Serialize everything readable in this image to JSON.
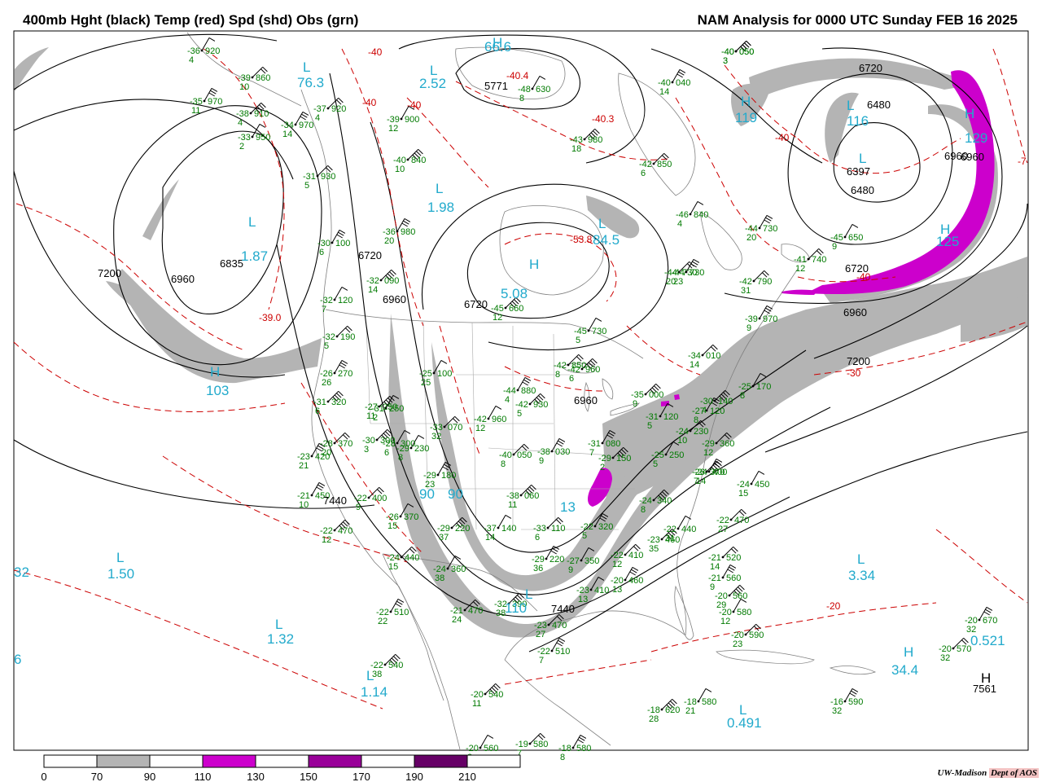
{
  "header": {
    "title_left": "400mb Hght (black) Temp (red) Spd (shd) Obs (grn)",
    "title_right": "NAM Analysis for 0000 UTC Sunday  FEB 16 2025"
  },
  "colors": {
    "height": "#000000",
    "temp": "#cc0000",
    "obs": "#007a00",
    "speed_label": "#22aacc",
    "shade_70": "#b4b4b4",
    "shade_110": "#cc00cc",
    "shade_150": "#990099",
    "shade_190": "#660066"
  },
  "legend": {
    "ticks": [
      "0",
      "70",
      "90",
      "110",
      "130",
      "150",
      "170",
      "190",
      "210"
    ]
  },
  "height_labels": [
    {
      "text": "6720"
    },
    {
      "text": "6480"
    },
    {
      "text": "6397"
    },
    {
      "text": "6480"
    },
    {
      "text": "6720"
    },
    {
      "text": "6960"
    },
    {
      "text": "6960"
    },
    {
      "text": "7200"
    },
    {
      "text": "7200"
    },
    {
      "text": "6960"
    },
    {
      "text": "6835"
    },
    {
      "text": "6960"
    },
    {
      "text": "6720"
    },
    {
      "text": "5771"
    },
    {
      "text": "6960"
    },
    {
      "text": "7440"
    },
    {
      "text": "7440"
    },
    {
      "text": "7561"
    },
    {
      "text": "6720"
    },
    {
      "text": "6960"
    }
  ],
  "temp_labels": [
    {
      "text": "-40"
    },
    {
      "text": "-40"
    },
    {
      "text": "-40"
    },
    {
      "text": "-40.4"
    },
    {
      "text": "-40.3"
    },
    {
      "text": "-53.8"
    },
    {
      "text": "-39.0"
    },
    {
      "text": "-40"
    },
    {
      "text": "-30"
    },
    {
      "text": "-20"
    },
    {
      "text": "-40"
    },
    {
      "text": "-7"
    }
  ],
  "speed_labels": [
    {
      "text": "66.6"
    },
    {
      "text": "76.3"
    },
    {
      "text": "2.52"
    },
    {
      "text": "1.98"
    },
    {
      "text": "1.87"
    },
    {
      "text": "5.08"
    },
    {
      "text": "84.5"
    },
    {
      "text": "103"
    },
    {
      "text": "1.50"
    },
    {
      "text": "1.32"
    },
    {
      "text": "1.14"
    },
    {
      "text": "0.491"
    },
    {
      "text": "3.34"
    },
    {
      "text": "0.521"
    },
    {
      "text": "34.4"
    },
    {
      "text": "129"
    },
    {
      "text": "125"
    },
    {
      "text": "119"
    },
    {
      "text": "116"
    },
    {
      "text": "90"
    },
    {
      "text": "90"
    },
    {
      "text": "110"
    },
    {
      "text": "13"
    },
    {
      "text": "32"
    },
    {
      "text": "6"
    }
  ],
  "pressure_centers": [
    {
      "text": "H"
    },
    {
      "text": "L"
    },
    {
      "text": "L"
    },
    {
      "text": "L"
    },
    {
      "text": "L"
    },
    {
      "text": "H"
    },
    {
      "text": "L"
    },
    {
      "text": "H"
    },
    {
      "text": "L"
    },
    {
      "text": "L"
    },
    {
      "text": "L"
    },
    {
      "text": "L"
    },
    {
      "text": "L"
    },
    {
      "text": "H"
    },
    {
      "text": "H"
    },
    {
      "text": "H"
    },
    {
      "text": "L"
    },
    {
      "text": "H"
    },
    {
      "text": "L"
    },
    {
      "text": "L"
    },
    {
      "text": "H"
    }
  ],
  "observations": [
    {
      "t": "-36",
      "h": "920",
      "d": "4"
    },
    {
      "t": "-39",
      "h": "860",
      "d": "10"
    },
    {
      "t": "-35",
      "h": "970",
      "d": "11"
    },
    {
      "t": "-38",
      "h": "910",
      "d": "4"
    },
    {
      "t": "-33",
      "h": "950",
      "d": "2"
    },
    {
      "t": "-31",
      "h": "930",
      "d": "5"
    },
    {
      "t": "-30",
      "h": "100",
      "d": "6"
    },
    {
      "t": "-32",
      "h": "090",
      "d": "14"
    },
    {
      "t": "-32",
      "h": "120",
      "d": "7"
    },
    {
      "t": "-32",
      "h": "190",
      "d": "5"
    },
    {
      "t": "-26",
      "h": "270",
      "d": "26"
    },
    {
      "t": "-31",
      "h": "320",
      "d": "6"
    },
    {
      "t": "-31",
      "h": "250",
      "d": "2"
    },
    {
      "t": "-28",
      "h": "370",
      "d": "20"
    },
    {
      "t": "-23",
      "h": "420",
      "d": "21"
    },
    {
      "t": "-30",
      "h": "300",
      "d": "3"
    },
    {
      "t": "-29",
      "h": "230",
      "d": "8"
    },
    {
      "t": "-22",
      "h": "400",
      "d": "9"
    },
    {
      "t": "-21",
      "h": "450",
      "d": "10"
    },
    {
      "t": "-22",
      "h": "470",
      "d": "12"
    },
    {
      "t": "-26",
      "h": "370",
      "d": "15"
    },
    {
      "t": "-24",
      "h": "440",
      "d": "15"
    },
    {
      "t": "-22",
      "h": "510",
      "d": "22"
    },
    {
      "t": "-22",
      "h": "540",
      "d": "38"
    },
    {
      "t": "-25",
      "h": "100",
      "d": "25"
    },
    {
      "t": "-33",
      "h": "070",
      "d": "32"
    },
    {
      "t": "-29",
      "h": "180",
      "d": "23"
    },
    {
      "t": "-29",
      "h": "220",
      "d": "37"
    },
    {
      "t": "-24",
      "h": "360",
      "d": "38"
    },
    {
      "t": "-21",
      "h": "470",
      "d": "24"
    },
    {
      "t": "-36",
      "h": "980",
      "d": "20"
    },
    {
      "t": "-40",
      "h": "840",
      "d": "10"
    },
    {
      "t": "-39",
      "h": "900",
      "d": "12"
    },
    {
      "t": "-37",
      "h": "920",
      "d": "4"
    },
    {
      "t": "-34",
      "h": "970",
      "d": "14"
    },
    {
      "t": "-43",
      "h": "980",
      "d": "18"
    },
    {
      "t": "-48",
      "h": "630",
      "d": "8"
    },
    {
      "t": "-42",
      "h": "850",
      "d": "6"
    },
    {
      "t": "-40",
      "h": "040",
      "d": "14"
    },
    {
      "t": "-40",
      "h": "050",
      "d": "3"
    },
    {
      "t": "-46",
      "h": "840",
      "d": "4"
    },
    {
      "t": "-44",
      "h": "730",
      "d": "20"
    },
    {
      "t": "-44",
      "h": "730",
      "d": "23"
    },
    {
      "t": "-45",
      "h": "660",
      "d": "12"
    },
    {
      "t": "-45",
      "h": "730",
      "d": "5"
    },
    {
      "t": "-42",
      "h": "850",
      "d": "8"
    },
    {
      "t": "-44",
      "h": "880",
      "d": "4"
    },
    {
      "t": "-42",
      "h": "930",
      "d": "5"
    },
    {
      "t": "-42",
      "h": "960",
      "d": "12"
    },
    {
      "t": "-40",
      "h": "050",
      "d": "8"
    },
    {
      "t": "-38",
      "h": "030",
      "d": "9"
    },
    {
      "t": "-38",
      "h": "060",
      "d": "11"
    },
    {
      "t": "-37",
      "h": "140",
      "d": "14"
    },
    {
      "t": "-33",
      "h": "110",
      "d": "6"
    },
    {
      "t": "-29",
      "h": "220",
      "d": "36"
    },
    {
      "t": "-32",
      "h": "390",
      "d": "38"
    },
    {
      "t": "-27",
      "h": "350",
      "d": "9"
    },
    {
      "t": "-23",
      "h": "470",
      "d": "27"
    },
    {
      "t": "-22",
      "h": "510",
      "d": "7"
    },
    {
      "t": "-20",
      "h": "540",
      "d": "11"
    },
    {
      "t": "-20",
      "h": "560",
      "d": "8"
    },
    {
      "t": "-19",
      "h": "580",
      "d": "7"
    },
    {
      "t": "-18",
      "h": "580",
      "d": "8"
    },
    {
      "t": "-35",
      "h": "000",
      "d": "9"
    },
    {
      "t": "-31",
      "h": "120",
      "d": "5"
    },
    {
      "t": "-34",
      "h": "010",
      "d": "14"
    },
    {
      "t": "-31",
      "h": "080",
      "d": "7"
    },
    {
      "t": "-29",
      "h": "150",
      "d": "2"
    },
    {
      "t": "-25",
      "h": "250",
      "d": "5"
    },
    {
      "t": "-24",
      "h": "230",
      "d": "10"
    },
    {
      "t": "-24",
      "h": "400",
      "d": "14"
    },
    {
      "t": "-24",
      "h": "340",
      "d": "8"
    },
    {
      "t": "-23",
      "h": "410",
      "d": "13"
    },
    {
      "t": "-22",
      "h": "410",
      "d": "12"
    },
    {
      "t": "-22",
      "h": "320",
      "d": "5"
    },
    {
      "t": "-26",
      "h": "370",
      "d": "7"
    },
    {
      "t": "-24",
      "h": "450",
      "d": "15"
    },
    {
      "t": "-22",
      "h": "470",
      "d": "27"
    },
    {
      "t": "-20",
      "h": "460",
      "d": "13"
    },
    {
      "t": "-23",
      "h": "460",
      "d": "35"
    },
    {
      "t": "-22",
      "h": "440",
      "d": "31"
    },
    {
      "t": "-21",
      "h": "520",
      "d": "14"
    },
    {
      "t": "-21",
      "h": "560",
      "d": "9"
    },
    {
      "t": "-20",
      "h": "560",
      "d": "29"
    },
    {
      "t": "-20",
      "h": "580",
      "d": "12"
    },
    {
      "t": "-20",
      "h": "590",
      "d": "23"
    },
    {
      "t": "-16",
      "h": "590",
      "d": "32"
    },
    {
      "t": "-18",
      "h": "620",
      "d": "28"
    },
    {
      "t": "-18",
      "h": "580",
      "d": "21"
    },
    {
      "t": "-20",
      "h": "570",
      "d": "32"
    },
    {
      "t": "-20",
      "h": "670",
      "d": "32"
    },
    {
      "t": "-27",
      "h": "250",
      "d": "11"
    },
    {
      "t": "-28",
      "h": "300",
      "d": "6"
    },
    {
      "t": "-29",
      "h": "360",
      "d": "12"
    },
    {
      "t": "-27",
      "h": "120",
      "d": "8"
    },
    {
      "t": "-30",
      "h": "140",
      "d": "4"
    },
    {
      "t": "-25",
      "h": "170",
      "d": "8"
    },
    {
      "t": "-42",
      "h": "790",
      "d": "31"
    },
    {
      "t": "-39",
      "h": "970",
      "d": "9"
    },
    {
      "t": "-40",
      "h": "050",
      "d": "3"
    },
    {
      "t": "-45",
      "h": "650",
      "d": "9"
    },
    {
      "t": "-41",
      "h": "740",
      "d": "12"
    },
    {
      "t": "-44",
      "h": "730",
      "d": "20"
    },
    {
      "t": "-42",
      "h": "960",
      "d": "6"
    }
  ],
  "credit": {
    "org": "UW-Madison",
    "dept": "Dept of AOS"
  }
}
